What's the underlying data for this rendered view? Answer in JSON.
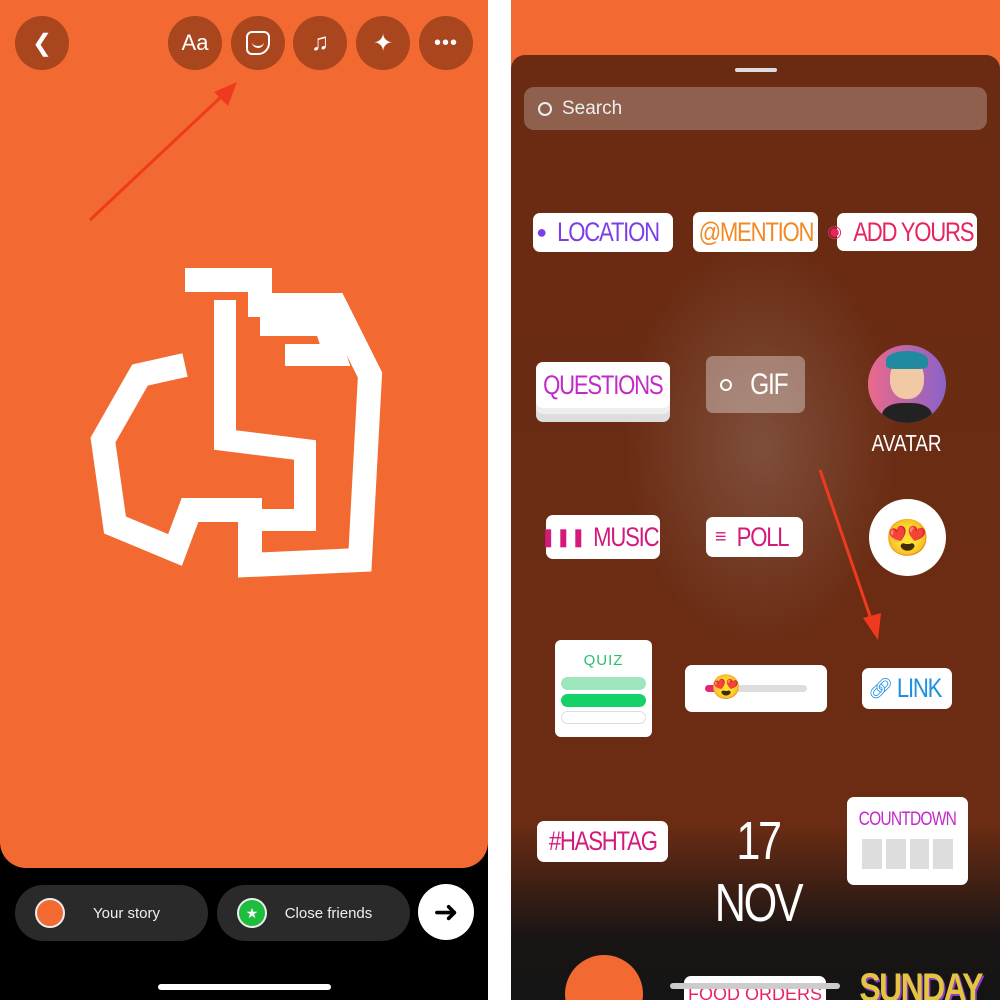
{
  "editor": {
    "toolbar": {
      "back": "back-icon",
      "text": "Aa",
      "sticker": "sticker-icon",
      "music": "music-icon",
      "effects": "sparkles-icon",
      "more": "more-icon"
    },
    "share": {
      "your_story": "Your story",
      "close_friends": "Close friends",
      "next": "arrow-right-icon"
    },
    "canvas_color": "#F26A32"
  },
  "sticker_tray": {
    "search_placeholder": "Search",
    "stickers": {
      "location": "LOCATION",
      "mention": "@MENTION",
      "add_yours": "ADD YOURS",
      "questions": "QUESTIONS",
      "gif": "GIF",
      "avatar": "AVATAR",
      "music": "MUSIC",
      "poll": "POLL",
      "emoji": "😍",
      "quiz": "QUIZ",
      "slider_emoji": "😍",
      "link": "LINK",
      "hashtag": "#HASHTAG",
      "date": "17 NOV",
      "countdown": "COUNTDOWN",
      "food_orders": "FOOD ORDERS",
      "day": "SUNDAY"
    },
    "colors": {
      "location": "#7B3FE4",
      "mention": "#F08A24",
      "add_yours": "#E8245E",
      "questions": "#C22BC9",
      "music": "#D4197A",
      "poll": "#D4197A",
      "quiz": "#2DBE6C",
      "link": "#1E8FE1",
      "hashtag": "#D4197A",
      "countdown": "#C22BC9"
    }
  },
  "annotation_color": "#F03A1E"
}
